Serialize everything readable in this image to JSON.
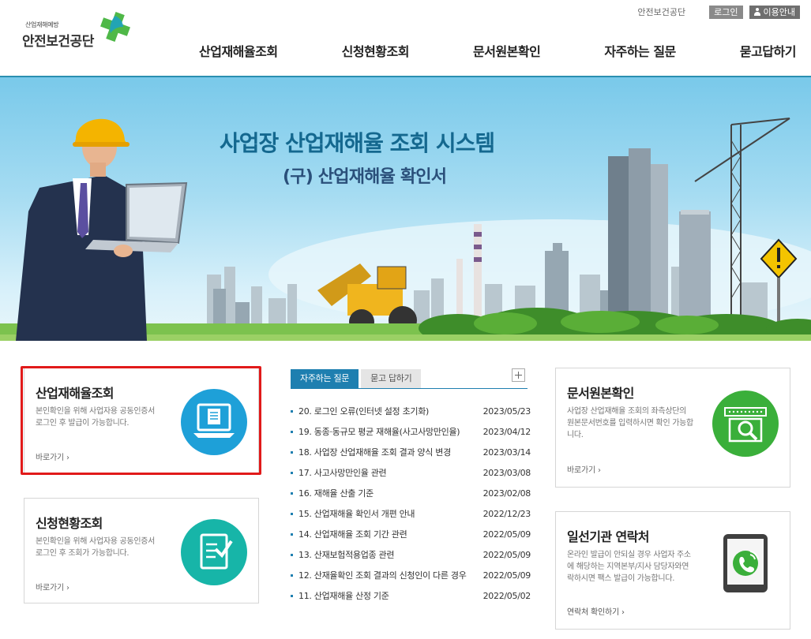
{
  "header": {
    "logo_small": "산업재해예방",
    "logo_text": "안전보건공단",
    "util_org": "안전보건공단",
    "login_label": "로그인",
    "guide_label": "이용안내",
    "nav": [
      {
        "label": "산업재해율조회"
      },
      {
        "label": "신청현황조회"
      },
      {
        "label": "문서원본확인"
      },
      {
        "label": "자주하는 질문"
      },
      {
        "label": "묻고답하기"
      }
    ]
  },
  "hero": {
    "title": "사업장 산업재해율 조회 시스템",
    "subtitle": "(구) 산업재해율 확인서"
  },
  "cards": {
    "rate_lookup": {
      "title": "산업재해율조회",
      "desc_line1": "본인확인을 위해 사업자용 공동인증서",
      "desc_line2": "로그인 후 발급이 가능합니다.",
      "link": "바로가기 ›"
    },
    "status_lookup": {
      "title": "신청현황조회",
      "desc_line1": "본인확인을 위해 사업자용 공동인증서",
      "desc_line2": "로그인 후 조회가 가능합니다.",
      "link": "바로가기 ›"
    },
    "doc_check": {
      "title": "문서원본확인",
      "desc_line1": "사업장 산업재해율 조회의 좌측상단의",
      "desc_line2": "원본문서번호를 입력하시면 확인 가능합",
      "desc_line3": "니다.",
      "link": "바로가기 ›"
    },
    "contact": {
      "title": "일선기관 연락처",
      "desc_line1": "온라인 발급이 안되실 경우 사업자 주소",
      "desc_line2": "에 해당하는 지역본부/지사 담당자와연",
      "desc_line3": "락하시면 팩스 발급이 가능합니다.",
      "link": "연락처 확인하기 ›"
    }
  },
  "faq": {
    "tab_active": "자주하는 질문",
    "tab_inactive": "묻고 답하기",
    "items": [
      {
        "title": "20. 로그인 오류(인터넷 설정 초기화)",
        "date": "2023/05/23"
      },
      {
        "title": "19. 동종·동규모 평균 재해율(사고사망만인율)",
        "date": "2023/04/12"
      },
      {
        "title": "18. 사업장 산업재해율 조회 결과 양식 변경",
        "date": "2023/03/14"
      },
      {
        "title": "17. 사고사망만인율 관련",
        "date": "2023/03/08"
      },
      {
        "title": "16. 재해율 산출 기준",
        "date": "2023/02/08"
      },
      {
        "title": "15. 산업재해율 확인서 개편 안내",
        "date": "2022/12/23"
      },
      {
        "title": "14. 산업재해율 조회 기간 관련",
        "date": "2022/05/09"
      },
      {
        "title": "13. 산재보험적용업종 관련",
        "date": "2022/05/09"
      },
      {
        "title": "12. 산재율확인 조회 결과의 신청인이 다른 경우",
        "date": "2022/05/09"
      },
      {
        "title": "11. 산업재해율 산정 기준",
        "date": "2022/05/02"
      }
    ]
  },
  "colors": {
    "accent_blue": "#1e7fb0",
    "highlight_red": "#e11a1a",
    "icon_blue": "#1ea0d8",
    "icon_teal": "#17b5a8",
    "icon_green": "#3aaf3a"
  }
}
